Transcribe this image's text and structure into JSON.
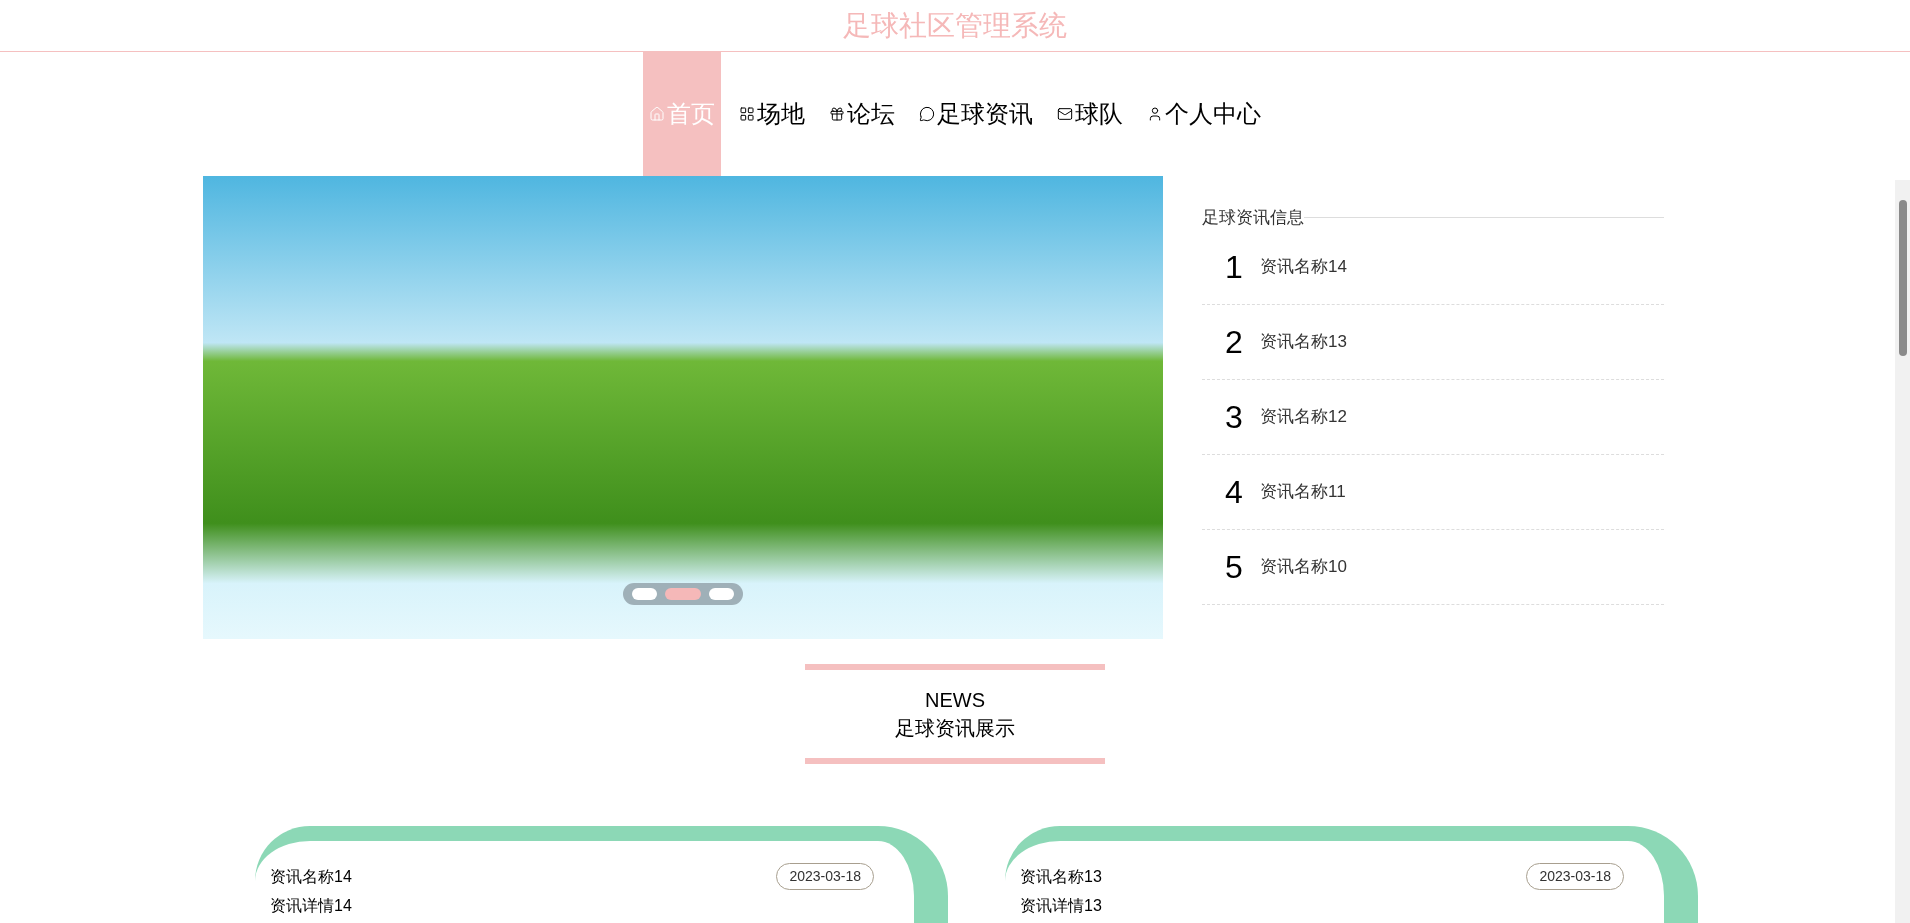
{
  "header": {
    "title": "足球社区管理系统"
  },
  "nav": [
    {
      "label": "首页",
      "selected": true
    },
    {
      "label": "场地",
      "selected": false
    },
    {
      "label": "论坛",
      "selected": false
    },
    {
      "label": "足球资讯",
      "selected": false
    },
    {
      "label": "球队",
      "selected": false
    },
    {
      "label": "个人中心",
      "selected": false
    }
  ],
  "carousel": {
    "dots": [
      {
        "selected": false
      },
      {
        "selected": true
      },
      {
        "selected": false
      }
    ]
  },
  "news_panel": {
    "title": "足球资讯信息",
    "items": [
      {
        "rank": "1",
        "name": "资讯名称14"
      },
      {
        "rank": "2",
        "name": "资讯名称13"
      },
      {
        "rank": "3",
        "name": "资讯名称12"
      },
      {
        "rank": "4",
        "name": "资讯名称11"
      },
      {
        "rank": "5",
        "name": "资讯名称10"
      }
    ]
  },
  "section_heading": {
    "english": "NEWS",
    "chinese": "足球资讯展示"
  },
  "news_cards": [
    {
      "name": "资讯名称14",
      "detail": "资讯详情14",
      "date": "2023-03-18"
    },
    {
      "name": "资讯名称13",
      "detail": "资讯详情13",
      "date": "2023-03-18"
    }
  ]
}
